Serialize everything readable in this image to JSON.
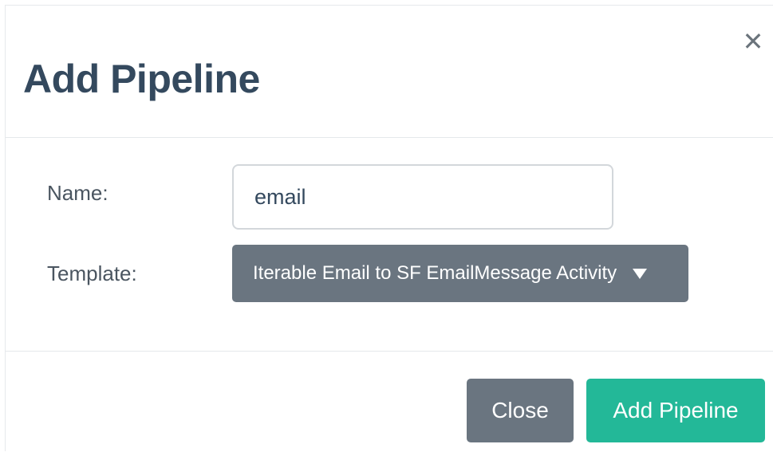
{
  "dialog": {
    "title": "Add Pipeline",
    "close_icon": "close-icon"
  },
  "form": {
    "name_label": "Name:",
    "name_value": "email",
    "template_label": "Template:",
    "template_selected": "Iterable Email to SF EmailMessage Activity",
    "template_icon": "caret-down-icon"
  },
  "footer": {
    "close_label": "Close",
    "add_label": "Add Pipeline"
  },
  "colors": {
    "title": "#34495e",
    "select_bg": "#6a7580",
    "close_button": "#6a7580",
    "primary_button": "#23b898"
  }
}
